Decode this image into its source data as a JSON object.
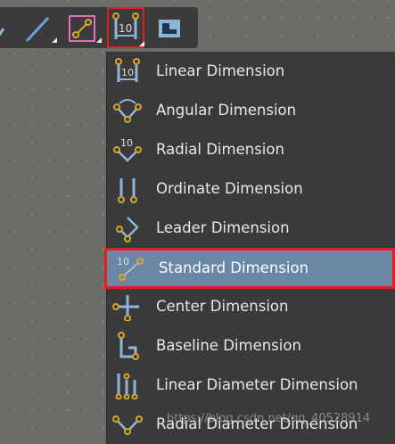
{
  "toolbar": {
    "buttons": [
      {
        "name": "arc-tool-partial",
        "icon": "arc-icon"
      },
      {
        "name": "line-tool",
        "icon": "line-icon"
      },
      {
        "name": "dimension-tool-pink",
        "icon": "dimension-point-icon"
      },
      {
        "name": "dimension-dropdown",
        "icon": "linear-dimension-icon",
        "active": true
      },
      {
        "name": "board-shape-tool",
        "icon": "board-icon"
      }
    ]
  },
  "menu": {
    "items": [
      {
        "label": "Linear Dimension",
        "icon": "linear-dimension-icon"
      },
      {
        "label": "Angular Dimension",
        "icon": "angular-dimension-icon"
      },
      {
        "label": "Radial Dimension",
        "icon": "radial-dimension-icon"
      },
      {
        "label": "Ordinate Dimension",
        "icon": "ordinate-dimension-icon"
      },
      {
        "label": "Leader Dimension",
        "icon": "leader-dimension-icon"
      },
      {
        "label": "Standard Dimension",
        "icon": "standard-dimension-icon",
        "selected": true
      },
      {
        "label": "Center Dimension",
        "icon": "center-dimension-icon"
      },
      {
        "label": "Baseline Dimension",
        "icon": "baseline-dimension-icon"
      },
      {
        "label": "Linear Diameter Dimension",
        "icon": "linear-diameter-dimension-icon"
      },
      {
        "label": "Radial Diameter Dimension",
        "icon": "radial-diameter-dimension-icon"
      }
    ]
  },
  "colors": {
    "selected_bg": "#6a87a6",
    "highlight_border": "#e02020",
    "menu_bg": "#3a3a3a",
    "icon_gold": "#d4a82a",
    "icon_blue": "#8fb4dc"
  },
  "watermark": "https://blog.csdn.net/qq_40528914"
}
